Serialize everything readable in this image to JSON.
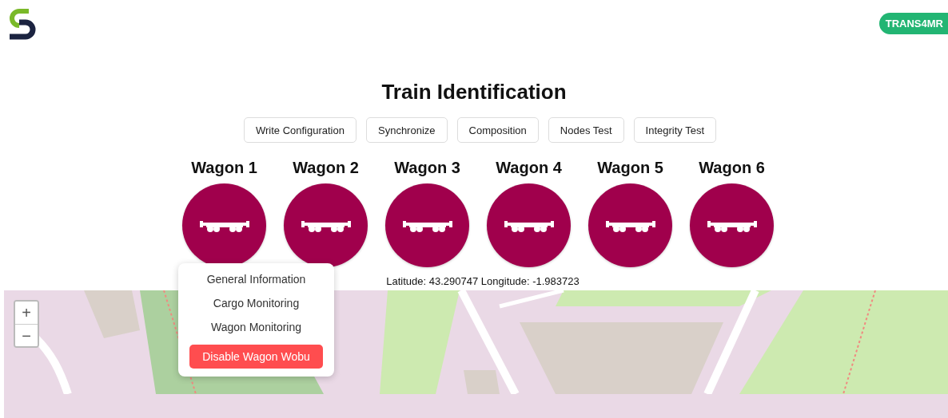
{
  "header": {
    "badge": "TRANS4MR"
  },
  "title": "Train Identification",
  "actions": [
    "Write Configuration",
    "Synchronize",
    "Composition",
    "Nodes Test",
    "Integrity Test"
  ],
  "wagons": [
    {
      "name": "Wagon 1"
    },
    {
      "name": "Wagon 2"
    },
    {
      "name": "Wagon 3"
    },
    {
      "name": "Wagon 4"
    },
    {
      "name": "Wagon 5"
    },
    {
      "name": "Wagon 6"
    }
  ],
  "wagon_menu": {
    "items": [
      {
        "label": "General Information",
        "kind": "option"
      },
      {
        "label": "Cargo Monitoring",
        "kind": "option"
      },
      {
        "label": "Wagon Monitoring",
        "kind": "option"
      },
      {
        "label": "Disable Wagon Wobu",
        "kind": "danger"
      }
    ]
  },
  "position": "Latitude: 43.290747 Longitude: -1.983723",
  "map": {
    "zoom_in": "+",
    "zoom_out": "−"
  }
}
